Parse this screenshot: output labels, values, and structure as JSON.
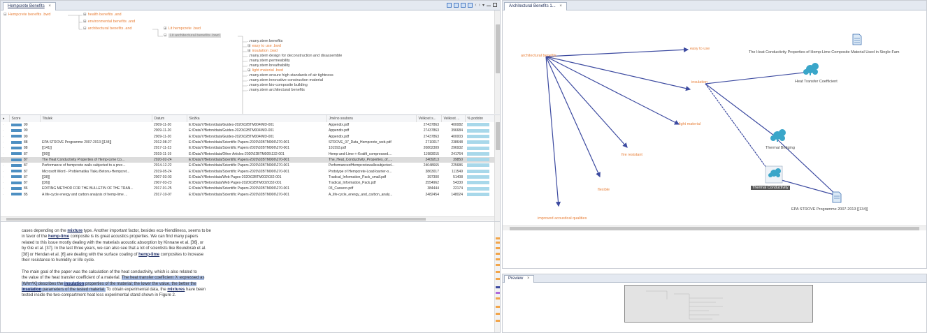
{
  "left_pane": {
    "tab_title": "Hempcrete Benefits",
    "tab_close": "×",
    "tree": {
      "root": "Hempcrete benefits .bwd",
      "level1": [
        {
          "label": "health benefits .and",
          "color": "orange"
        },
        {
          "label": "environmental benefits .and",
          "color": "orange"
        },
        {
          "label": "architectural benefits .and",
          "color": "orange"
        }
      ],
      "level2": [
        {
          "label": "Lit hempcrete .bwd",
          "color": "orange"
        },
        {
          "label": "Lit architectural benefits .bwd",
          "color": "gray",
          "selected": true
        }
      ],
      "level3": [
        {
          "label": "..many.stem benefits",
          "color": "dark"
        },
        {
          "label": "easy to use .bwd",
          "color": "orange"
        },
        {
          "label": "insulation .bwd",
          "color": "orange"
        },
        {
          "label": "..many.stem design for deconstruction and disassemble",
          "color": "dark"
        },
        {
          "label": "..many.stem permeability",
          "color": "dark"
        },
        {
          "label": "..many.stem breathability",
          "color": "dark"
        },
        {
          "label": "light material .bwd",
          "color": "orange"
        },
        {
          "label": "..many.stem ensure high standards of air tightness",
          "color": "dark"
        },
        {
          "label": "..many.stem innovative construction material",
          "color": "dark"
        },
        {
          "label": "..many.stem bio-composite building",
          "color": "dark"
        },
        {
          "label": "..many.stem architectural benefits",
          "color": "dark"
        }
      ]
    },
    "results_table": {
      "columns": [
        "Score",
        "Titulek",
        "Datum",
        "Složka",
        "Jméno souboru",
        "Velikost s...",
        "Velikost ...",
        "% podobn"
      ],
      "rows": [
        {
          "score": "90",
          "title": "",
          "date": "2009-11-20",
          "folder": "E:/Data/Y/Beton/data/Guides-2020\\02BTM004\\MD-001",
          "file": "Appendix.pdf",
          "size1": "27437863",
          "size2": "400082",
          "score_fill": 0.55
        },
        {
          "score": "90",
          "title": "",
          "date": "2009-11-20",
          "folder": "E:/Data/Y/Beton/data/Guides-2020\\02BTM004\\MD-001",
          "file": "Appendix.pdf",
          "size1": "27437863",
          "size2": "396684",
          "score_fill": 0.55
        },
        {
          "score": "90",
          "title": "",
          "date": "2009-11-20",
          "folder": "E:/Data/Y/Beton/data/Guides-2020\\02BTM004\\MD-001",
          "file": "Appendix.pdf",
          "size1": "27437863",
          "size2": "400003",
          "score_fill": 0.55
        },
        {
          "score": "88",
          "title": "EPA STROVE Programme 2007-2013 [[134]]",
          "date": "2012-08-27",
          "folder": "E:/Data/Y/Beton/data/Scientific Papers-2020\\02BTM006\\270-001",
          "file": "STROVE_07_Data_Hempcrete_web.pdf",
          "size1": "2710017",
          "size2": "238648",
          "score_fill": 0.55
        },
        {
          "score": "88",
          "title": "[[141]]",
          "date": "2017-11-23",
          "folder": "E:/Data/Y/Beton/data/Scientific Papers-2020\\02BTM006\\270-001",
          "file": "101593.pdf",
          "size1": "20802309",
          "size2": "296932",
          "score_fill": 0.55
        },
        {
          "score": "87",
          "title": "[[99]]",
          "date": "2019-11-19",
          "folder": "E:/Data/Y/Beton/data/Other Articles-2020\\02BTM005\\132-001",
          "file": "Hemp-and-Lime-+-Kratift_compressed....",
          "size1": "11983015",
          "size2": "241764",
          "score_fill": 0.55
        },
        {
          "score": "87",
          "title": "The Heat Conductivity Properties of Hemp-Lime Co...",
          "date": "2020-02-24",
          "folder": "E:/Data/Y/Beton/data/Scientific Papers-2020\\02BTM006\\270-001",
          "file": "The_Heat_Conductivity_Properties_of_...",
          "size1": "2409213",
          "size2": "39850",
          "score_fill": 0.55,
          "selected": true
        },
        {
          "score": "87",
          "title": "Performance of hempcrete walls subjected to a prec...",
          "date": "2014-12-22",
          "folder": "E:/Data/Y/Beton/data/Scientific Papers-2020\\02BTM006\\270-001",
          "file": "PerformanceofHempcretewallssubjected...",
          "size1": "24048665",
          "size2": "225686",
          "score_fill": 0.55
        },
        {
          "score": "87",
          "title": "Microsoft Word - Problematika Tlaku Betonu-Hempcret...",
          "date": "2019-05-24",
          "folder": "E:/Data/Y/Beton/data/Scientific Papers-2020\\02BTM006\\270-001",
          "file": "Prototype of Hempcrete-Load-barrier-o...",
          "size1": "3863017",
          "size2": "111549",
          "score_fill": 0.55
        },
        {
          "score": "87",
          "title": "[[38]]",
          "date": "2007-03-03",
          "folder": "E:/Data/Y/Beton/data/Web Pages-2020\\02BTM002\\032-001",
          "file": "Tradical_Information_Pack_small.pdf",
          "size1": "397300",
          "size2": "51408",
          "score_fill": 0.55
        },
        {
          "score": "87",
          "title": "[[36]]",
          "date": "2007-03-23",
          "folder": "E:/Data/Y/Beton/data/Web Pages-2020\\02BTM002\\032-001",
          "file": "Tradical_Information_Pack.pdf",
          "size1": "2554962",
          "size2": "54330",
          "score_fill": 0.55
        },
        {
          "score": "86",
          "title": "EDITING METHOD FOR THE BULLETIN OF THE TRAN...",
          "date": "2017-01-25",
          "folder": "E:/Data/Y/Beton/data/Scientific Papers-2020\\02BTM006\\270-001",
          "file": "03_Cassero.pdf",
          "size1": "384444",
          "size2": "22174",
          "score_fill": 0.55
        },
        {
          "score": "85",
          "title": "A life-cycle energy and carbon analysis of hemp-lime ...",
          "date": "2017-10-07",
          "folder": "E:/Data/Y/Beton/data/Scientific Papers-2020\\02BTM006\\270-001",
          "file": "A_life-cycle_energy_and_carbon_analy...",
          "size1": "2482454",
          "size2": "148024",
          "score_fill": 0.55
        }
      ]
    },
    "document": {
      "lines": [
        [
          {
            "t": "cases depending on the "
          },
          {
            "t": "mixture",
            "kw": true
          },
          {
            "t": " type. Another important factor, besides eco-friendliness, seems to be"
          }
        ],
        [
          {
            "t": "in favor of the "
          },
          {
            "t": "hemp-lime",
            "kw": true
          },
          {
            "t": " composite is its great acoustics properties. We can find many papers"
          }
        ],
        [
          {
            "t": "related to this issue mostly dealing with the materials acoustic absorption by Kinnane et al. [36], or"
          }
        ],
        [
          {
            "t": "by Gle et al. [37]. In the last three years, we can also see that a lot of scientists like Bourebrab et al."
          }
        ],
        [
          {
            "t": "[38] or Hendan et al. [6] are dealing with the surface coating of "
          },
          {
            "t": "hemp-lime",
            "kw": true
          },
          {
            "t": " composites to increase"
          }
        ],
        [
          {
            "t": "their resistance to humidity or life cycle."
          }
        ],
        [
          {
            "t": ""
          }
        ],
        [
          {
            "t": "The main goal of the paper was the calculation of the heat conductivity, which is also related to"
          }
        ],
        [
          {
            "t": "the value of the heat transfer coefficient of a material. "
          },
          {
            "t": "The heat transfer coefficient 'λ' expressed as",
            "hl": true
          }
        ],
        [
          {
            "t": "[W/m*K] describes the ",
            "hl": true
          },
          {
            "t": "insulation",
            "hl": true,
            "kw": true
          },
          {
            "t": " properties of the material; the lower the value, the better the",
            "hl": true
          }
        ],
        [
          {
            "t": "insulation",
            "hl": true,
            "kw": true
          },
          {
            "t": " parameters of the tested material.",
            "hl": true
          },
          {
            "t": " To obtain experimental data, the "
          },
          {
            "t": "mixtures",
            "kw": true
          },
          {
            "t": " have been"
          }
        ],
        [
          {
            "t": "tested inside the two-compartment heat loss experimental stand shown in Figure 2."
          }
        ]
      ]
    }
  },
  "right_top": {
    "tab_title": "Architectural Benefits 1...",
    "tab_close": "×",
    "graph": {
      "nodes": {
        "architectural_benefits": "architectural benefits",
        "easy_to_use": "easy to use",
        "insulation": "insulation",
        "light_material": "light material",
        "fire_resistant": "fire resistant",
        "flexible": "flexible",
        "improved_acoustical_qualities": "improved acoustical qualities",
        "heat_transfer_coefficient": "Heat Transfer Coefficient",
        "thermal_bridging": "Thermal Bridging",
        "thermal_conductivity": "Thermal Conductivity",
        "doc_heat_conductivity": "The Heat Conductivity Properties of Hemp-Lime Composite Material Used in Single-Fam",
        "doc_epa": "EPA STROVE Programme 2007-2013 [[134]]"
      }
    }
  },
  "right_bottom": {
    "tab_title": "Preview",
    "tab_close": "×"
  },
  "colors": {
    "accent_orange": "#e8803a",
    "edge_blue": "#3c4aa0",
    "node_teal": "#3aa6c9",
    "highlight": "#a9bde3",
    "score_bar": "#4d8fc2"
  }
}
